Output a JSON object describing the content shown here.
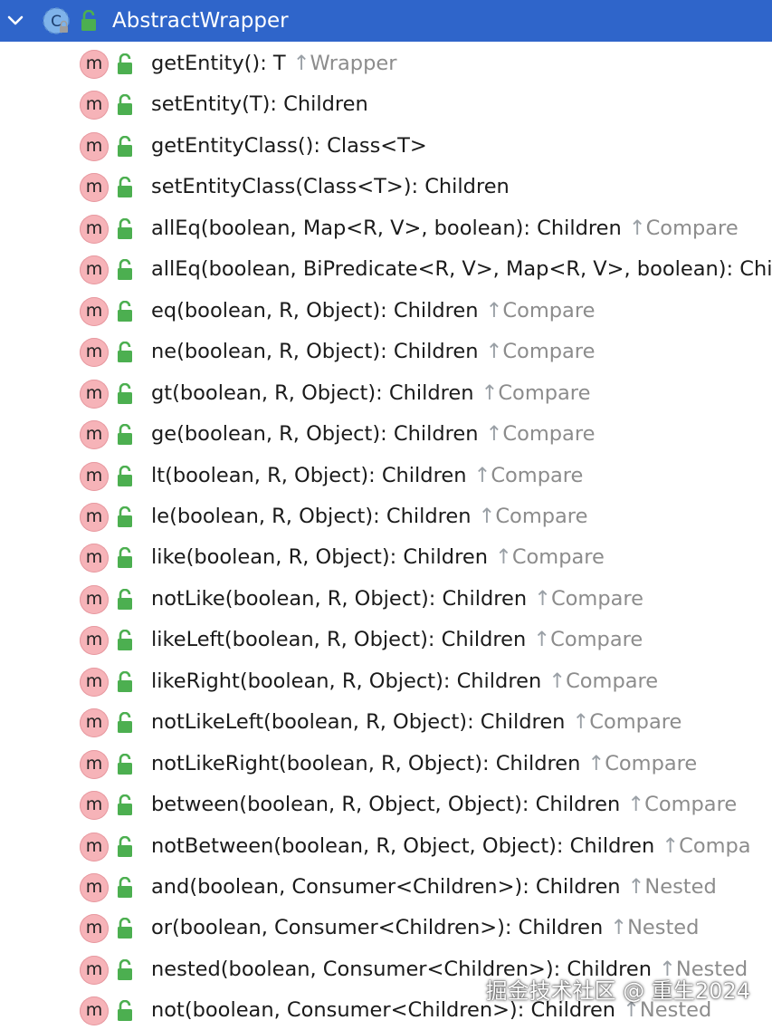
{
  "header": {
    "title": "AbstractWrapper",
    "class_icon_letter": "C",
    "background": "#2f65ca"
  },
  "icons": {
    "method_icon_letter": "m",
    "method_icon_color": "#f6b3b8",
    "access_icon": "public-lock-icon",
    "access_icon_color": "#4caf50",
    "super_arrow": "↑"
  },
  "members": [
    {
      "signature": "getEntity(): T",
      "super": "Wrapper"
    },
    {
      "signature": "setEntity(T): Children",
      "super": ""
    },
    {
      "signature": "getEntityClass(): Class<T>",
      "super": ""
    },
    {
      "signature": "setEntityClass(Class<T>): Children",
      "super": ""
    },
    {
      "signature": "allEq(boolean, Map<R, V>, boolean): Children",
      "super": "Compare"
    },
    {
      "signature": "allEq(boolean, BiPredicate<R, V>, Map<R, V>, boolean): Chi",
      "super": ""
    },
    {
      "signature": "eq(boolean, R, Object): Children",
      "super": "Compare"
    },
    {
      "signature": "ne(boolean, R, Object): Children",
      "super": "Compare"
    },
    {
      "signature": "gt(boolean, R, Object): Children",
      "super": "Compare"
    },
    {
      "signature": "ge(boolean, R, Object): Children",
      "super": "Compare"
    },
    {
      "signature": "lt(boolean, R, Object): Children",
      "super": "Compare"
    },
    {
      "signature": "le(boolean, R, Object): Children",
      "super": "Compare"
    },
    {
      "signature": "like(boolean, R, Object): Children",
      "super": "Compare"
    },
    {
      "signature": "notLike(boolean, R, Object): Children",
      "super": "Compare"
    },
    {
      "signature": "likeLeft(boolean, R, Object): Children",
      "super": "Compare"
    },
    {
      "signature": "likeRight(boolean, R, Object): Children",
      "super": "Compare"
    },
    {
      "signature": "notLikeLeft(boolean, R, Object): Children",
      "super": "Compare"
    },
    {
      "signature": "notLikeRight(boolean, R, Object): Children",
      "super": "Compare"
    },
    {
      "signature": "between(boolean, R, Object, Object): Children",
      "super": "Compare"
    },
    {
      "signature": "notBetween(boolean, R, Object, Object): Children",
      "super": "Compa"
    },
    {
      "signature": "and(boolean, Consumer<Children>): Children",
      "super": "Nested"
    },
    {
      "signature": "or(boolean, Consumer<Children>): Children",
      "super": "Nested"
    },
    {
      "signature": "nested(boolean, Consumer<Children>): Children",
      "super": "Nested"
    },
    {
      "signature": "not(boolean, Consumer<Children>): Children",
      "super": "Nested"
    }
  ],
  "watermark": "掘金技术社区 @ 重生2024"
}
